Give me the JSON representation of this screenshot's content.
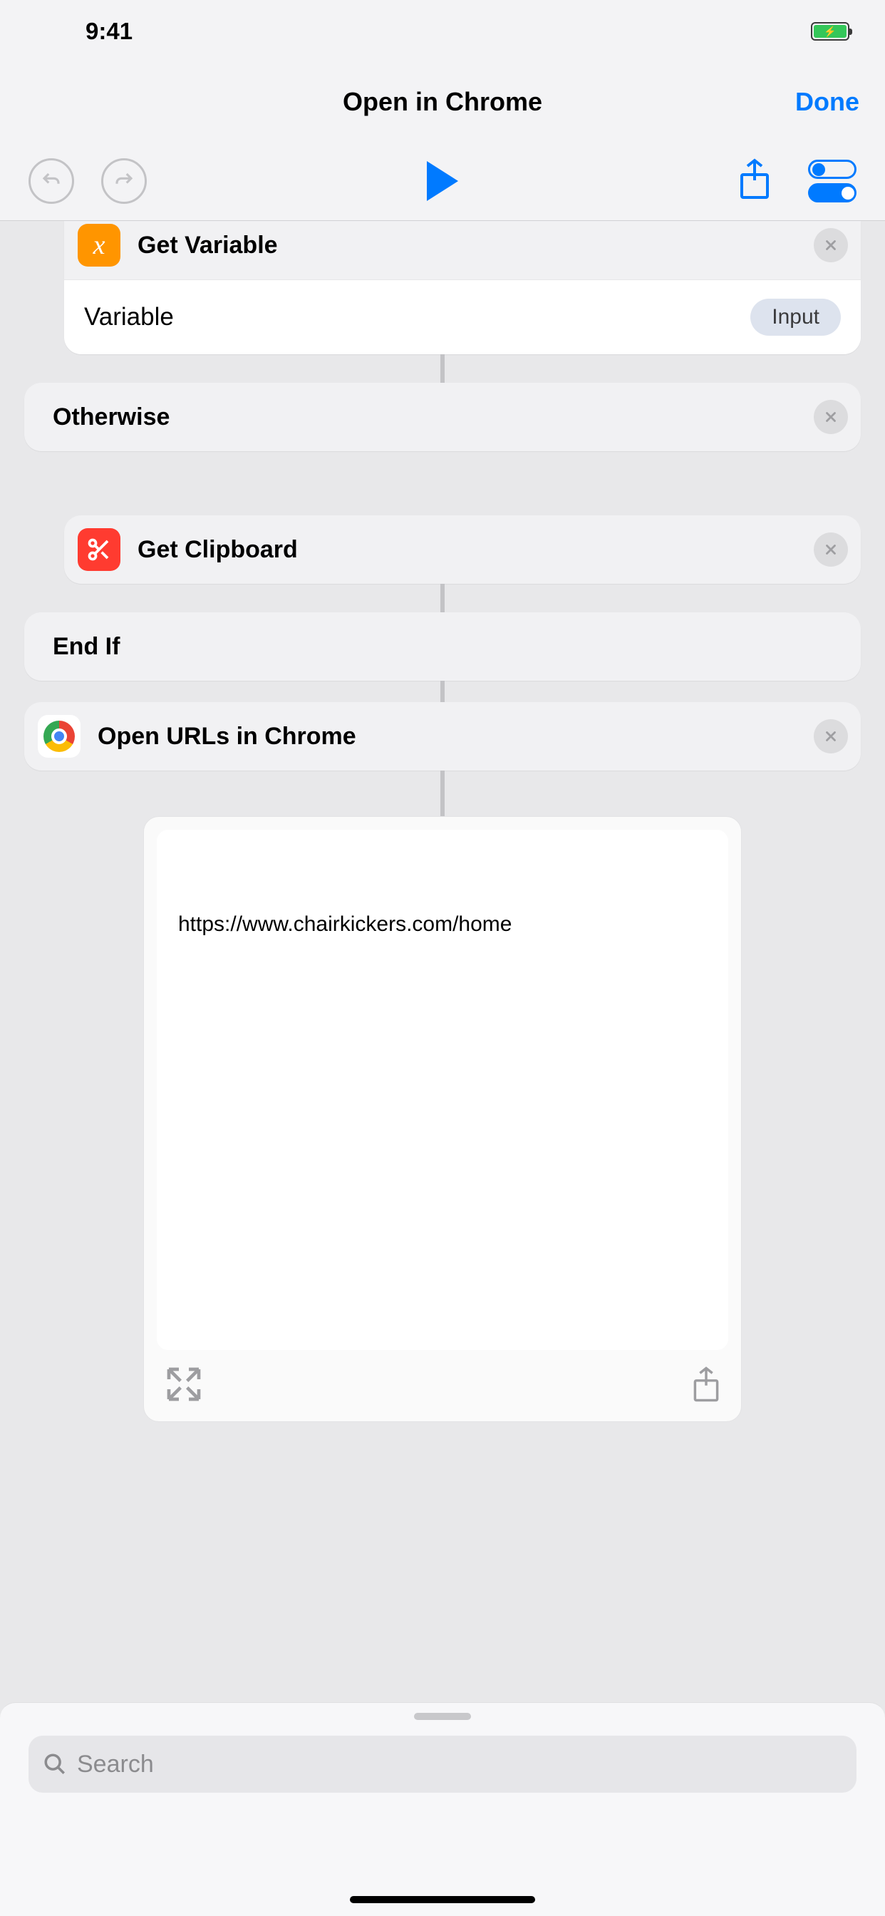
{
  "status": {
    "time": "9:41"
  },
  "nav": {
    "title": "Open in Chrome",
    "done": "Done"
  },
  "actions": {
    "get_variable": {
      "title": "Get Variable",
      "param_label": "Variable",
      "param_token": "Input"
    },
    "otherwise": {
      "title": "Otherwise"
    },
    "get_clipboard": {
      "title": "Get Clipboard"
    },
    "end_if": {
      "title": "End If"
    },
    "open_urls": {
      "title": "Open URLs in Chrome"
    }
  },
  "result": {
    "url": "https://www.chairkickers.com/home"
  },
  "search": {
    "placeholder": "Search"
  }
}
